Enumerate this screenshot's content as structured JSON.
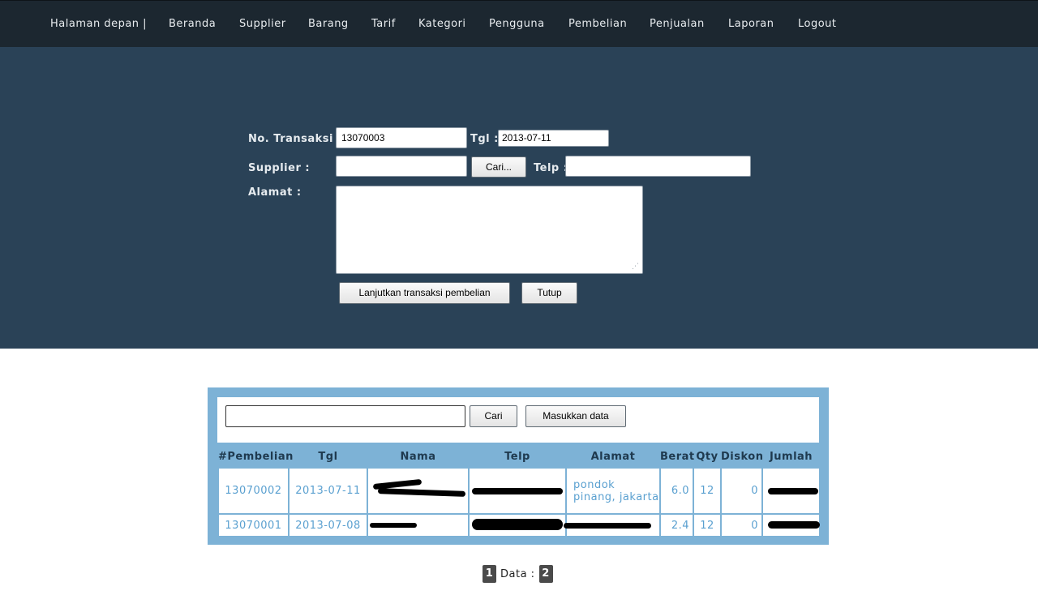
{
  "nav": {
    "items": [
      "Halaman depan |",
      "Beranda",
      "Supplier",
      "Barang",
      "Tarif",
      "Kategori",
      "Pengguna",
      "Pembelian",
      "Penjualan",
      "Laporan",
      "Logout"
    ]
  },
  "form": {
    "no_transaksi_label": "No. Transaksi :",
    "no_transaksi_value": "13070003",
    "tgl_label": "Tgl :",
    "tgl_value": "2013-07-11",
    "supplier_label": "Supplier :",
    "supplier_value": "",
    "cari_button": "Cari...",
    "telp_label": "Telp :",
    "telp_value": "",
    "alamat_label": "Alamat :",
    "alamat_value": "",
    "lanjutkan_button": "Lanjutkan transaksi pembelian",
    "tutup_button": "Tutup"
  },
  "table_panel": {
    "search_value": "",
    "cari_button": "Cari",
    "masukkan_button": "Masukkan data",
    "columns": [
      "#Pembelian",
      "Tgl",
      "Nama",
      "Telp",
      "Alamat",
      "Berat",
      "Qty",
      "Diskon",
      "Jumlah"
    ],
    "rows": [
      {
        "id": "13070002",
        "tgl": "2013-07-11",
        "nama": "",
        "telp": "",
        "alamat": "pondok pinang, jakarta",
        "berat": "6.0",
        "qty": "12",
        "diskon": "0",
        "jumlah": ""
      },
      {
        "id": "13070001",
        "tgl": "2013-07-08",
        "nama": "",
        "telp": "",
        "alamat": "",
        "berat": "2.4",
        "qty": "12",
        "diskon": "0",
        "jumlah": ""
      }
    ]
  },
  "pagination": {
    "page_1": "1",
    "label": "Data :",
    "page_2": "2"
  },
  "colors": {
    "nav_bg": "#1c2730",
    "band_bg": "#2a4257",
    "panel_bg": "#7db2d6",
    "link_text": "#5aa0d0"
  }
}
